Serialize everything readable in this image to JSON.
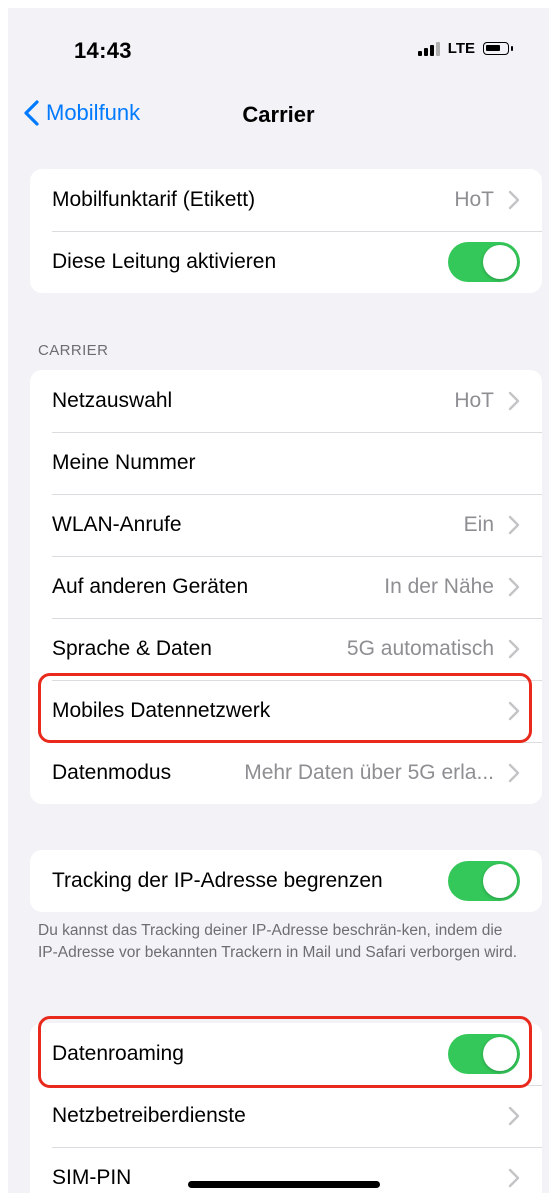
{
  "status_bar": {
    "time": "14:43",
    "network": "LTE"
  },
  "nav": {
    "back_label": "Mobilfunk",
    "title": "Carrier"
  },
  "group1": {
    "rows": [
      {
        "label": "Mobilfunktarif (Etikett)",
        "value": "HoT"
      },
      {
        "label": "Diese Leitung aktivieren",
        "toggle": "on"
      }
    ]
  },
  "carrier_section": {
    "header": "CARRIER",
    "rows": [
      {
        "label": "Netzauswahl",
        "value": "HoT"
      },
      {
        "label": "Meine Nummer",
        "value": ""
      },
      {
        "label": "WLAN-Anrufe",
        "value": "Ein"
      },
      {
        "label": "Auf anderen Geräten",
        "value": "In der Nähe"
      },
      {
        "label": "Sprache & Daten",
        "value": "5G automatisch"
      },
      {
        "label": "Mobiles Datennetzwerk",
        "value": ""
      },
      {
        "label": "Datenmodus",
        "value": "Mehr Daten über 5G erla..."
      }
    ]
  },
  "tracking_section": {
    "label": "Tracking der IP-Adresse begrenzen",
    "toggle": "on",
    "footer": "Du kannst das Tracking deiner IP-Adresse beschrän-ken, indem die IP-Adresse vor bekannten Trackern in Mail und Safari verborgen wird."
  },
  "roaming_section": {
    "rows": [
      {
        "label": "Datenroaming",
        "toggle": "on"
      },
      {
        "label": "Netzbetreiberdienste",
        "value": ""
      },
      {
        "label": "SIM-PIN",
        "value": ""
      }
    ]
  },
  "colors": {
    "accent": "#007aff",
    "toggle_on": "#34c759",
    "highlight": "#e8291c",
    "background": "#f2f2f7"
  }
}
